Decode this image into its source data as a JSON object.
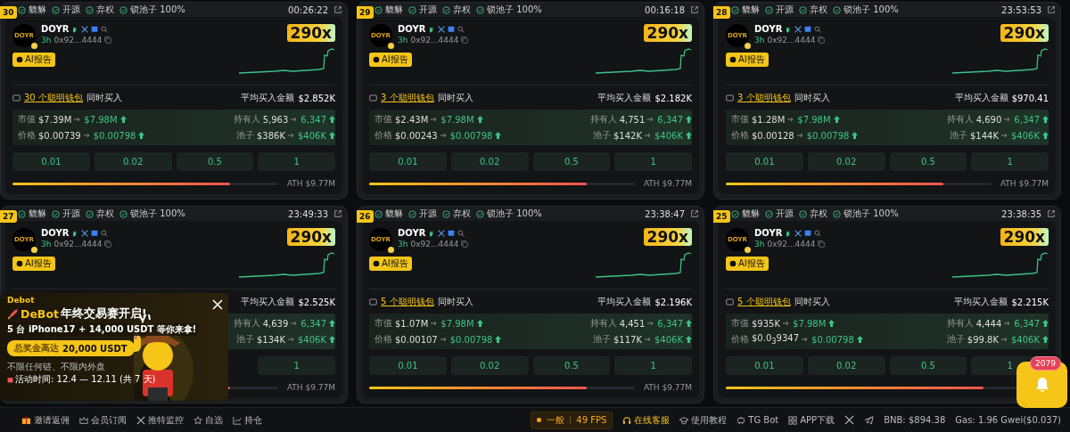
{
  "cards": [
    {
      "rank": "30",
      "tags": [
        "貔貅",
        "开源",
        "弃权",
        "锁池子 100%"
      ],
      "time": "00:26:22",
      "token": {
        "logo_text": "DOYR",
        "name": "DOYR",
        "age": "3h",
        "address": "0x92...4444"
      },
      "multiplier": "290x",
      "ai_label": "AI报告",
      "wallets": {
        "link": "30 个聪明钱包",
        "text": "同时买入"
      },
      "avg": {
        "label": "平均买入金额",
        "value": "$2.852K"
      },
      "stats_left": [
        {
          "label": "市值",
          "from": "$7.39M",
          "to": "$7.98M"
        },
        {
          "label": "价格",
          "from": "$0.00739",
          "to": "$0.00798"
        }
      ],
      "stats_right": [
        {
          "label": "持有人",
          "from": "5,963",
          "to": "6,347"
        },
        {
          "label": "池子",
          "from": "$386K",
          "to": "$406K"
        }
      ],
      "buttons": [
        "0.01",
        "0.02",
        "0.5",
        "1"
      ],
      "progress": {
        "level": 0.82,
        "ath": "ATH $9.77M"
      }
    },
    {
      "rank": "29",
      "tags": [
        "貔貅",
        "开源",
        "弃权",
        "锁池子 100%"
      ],
      "time": "00:16:18",
      "token": {
        "logo_text": "DOYR",
        "name": "DOYR",
        "age": "3h",
        "address": "0x92...4444"
      },
      "multiplier": "290x",
      "ai_label": "AI报告",
      "wallets": {
        "link": "3 个聪明钱包",
        "text": "同时买入"
      },
      "avg": {
        "label": "平均买入金额",
        "value": "$2.182K"
      },
      "stats_left": [
        {
          "label": "市值",
          "from": "$2.43M",
          "to": "$7.98M"
        },
        {
          "label": "价格",
          "from": "$0.00243",
          "to": "$0.00798"
        }
      ],
      "stats_right": [
        {
          "label": "持有人",
          "from": "4,751",
          "to": "6,347"
        },
        {
          "label": "池子",
          "from": "$142K",
          "to": "$406K"
        }
      ],
      "buttons": [
        "0.01",
        "0.02",
        "0.5",
        "1"
      ],
      "progress": {
        "level": 0.82,
        "ath": "ATH $9.77M"
      }
    },
    {
      "rank": "28",
      "tags": [
        "貔貅",
        "开源",
        "弃权",
        "锁池子 100%"
      ],
      "time": "23:53:53",
      "token": {
        "logo_text": "DOYR",
        "name": "DOYR",
        "age": "3h",
        "address": "0x92...4444"
      },
      "multiplier": "290x",
      "ai_label": "AI报告",
      "wallets": {
        "link": "3 个聪明钱包",
        "text": "同时买入"
      },
      "avg": {
        "label": "平均买入金额",
        "value": "$970.41"
      },
      "stats_left": [
        {
          "label": "市值",
          "from": "$1.28M",
          "to": "$7.98M"
        },
        {
          "label": "价格",
          "from": "$0.00128",
          "to": "$0.00798"
        }
      ],
      "stats_right": [
        {
          "label": "持有人",
          "from": "4,690",
          "to": "6,347"
        },
        {
          "label": "池子",
          "from": "$144K",
          "to": "$406K"
        }
      ],
      "buttons": [
        "0.01",
        "0.02",
        "0.5",
        "1"
      ],
      "progress": {
        "level": 0.82,
        "ath": "ATH $9.77M"
      }
    },
    {
      "rank": "27",
      "tags": [
        "貔貅",
        "开源",
        "弃权",
        "锁池子 100%"
      ],
      "time": "23:49:33",
      "token": {
        "logo_text": "DOYR",
        "name": "DOYR",
        "age": "3h",
        "address": "0x92...4444"
      },
      "multiplier": "290x",
      "ai_label": "AI报告",
      "avg": {
        "label": "平均买入金额",
        "value": "$2.525K"
      },
      "stats_right": [
        {
          "label": "持有人",
          "from": "4,639",
          "to": "6,347"
        },
        {
          "label": "池子",
          "from": "$134K",
          "to": "$406K"
        }
      ],
      "buttons": [
        "1"
      ],
      "progress": {
        "level": 0.82,
        "ath": "ATH $9.77M"
      }
    },
    {
      "rank": "26",
      "tags": [
        "貔貅",
        "开源",
        "弃权",
        "锁池子 100%"
      ],
      "time": "23:38:47",
      "token": {
        "logo_text": "DOYR",
        "name": "DOYR",
        "age": "3h",
        "address": "0x92...4444"
      },
      "multiplier": "290x",
      "ai_label": "AI报告",
      "wallets": {
        "link": "5 个聪明钱包",
        "text": "同时买入"
      },
      "avg": {
        "label": "平均买入金额",
        "value": "$2.196K"
      },
      "stats_left": [
        {
          "label": "市值",
          "from": "$1.07M",
          "to": "$7.98M"
        },
        {
          "label": "价格",
          "from": "$0.00107",
          "to": "$0.00798"
        }
      ],
      "stats_right": [
        {
          "label": "持有人",
          "from": "4,451",
          "to": "6,347"
        },
        {
          "label": "池子",
          "from": "$117K",
          "to": "$406K"
        }
      ],
      "buttons": [
        "0.01",
        "0.02",
        "0.5",
        "1"
      ],
      "progress": {
        "level": 0.82,
        "ath": "ATH $9.77M"
      }
    },
    {
      "rank": "25",
      "tags": [
        "貔貅",
        "开源",
        "弃权",
        "锁池子 100%"
      ],
      "time": "23:38:35",
      "token": {
        "logo_text": "DOYR",
        "name": "DOYR",
        "age": "3h",
        "address": "0x92...4444"
      },
      "multiplier": "290x",
      "ai_label": "AI报告",
      "wallets": {
        "link": "5 个聪明钱包",
        "text": "同时买入"
      },
      "avg": {
        "label": "平均买入金额",
        "value": "$2.215K"
      },
      "stats_left": [
        {
          "label": "市值",
          "from": "$935K",
          "to": "$7.98M"
        },
        {
          "label": "价格",
          "from": "$0.0$_{3}$9347",
          "to": "$0.00798"
        }
      ],
      "stats_right": [
        {
          "label": "持有人",
          "from": "4,444",
          "to": "6,347"
        },
        {
          "label": "池子",
          "from": "$99.8K",
          "to": "$406K"
        }
      ],
      "buttons": [
        "0.01",
        "0.02",
        "0.5",
        "1"
      ],
      "progress": {
        "level": 0.82
      }
    }
  ],
  "promo": {
    "brand": "Debot",
    "title_brand": "DeBot",
    "title": "年终交易赛开启!",
    "subtitle": "5 台 iPhone17 + 14,000 USDT 等你来拿!",
    "prize_label": "总奖金高达",
    "prize_value": "20,000 USDT",
    "note": "不限任何链、不限内外盘",
    "period": "活动时间: 12.4 — 12.11 (共 7 天)"
  },
  "notifications": {
    "count": "2079"
  },
  "footer": {
    "left": [
      {
        "kind": "gift",
        "label": "邀请返佣"
      },
      {
        "kind": "crown",
        "label": "会员订阅"
      },
      {
        "kind": "x",
        "label": "推特监控"
      },
      {
        "kind": "star",
        "label": "自选"
      },
      {
        "kind": "chart",
        "label": "持仓"
      }
    ],
    "status": {
      "label": "一般",
      "fps": "49 FPS"
    },
    "right": [
      {
        "kind": "headset",
        "label": "在线客服",
        "highlight": true
      },
      {
        "kind": "cap",
        "label": "使用教程",
        "highlight": false
      },
      {
        "kind": "robot",
        "label": "TG Bot",
        "highlight": false
      },
      {
        "kind": "grid",
        "label": "APP下载",
        "highlight": false
      }
    ],
    "bnb": "BNB: $894.38",
    "gas": "Gas: 1.96 Gwei($0.037)"
  }
}
